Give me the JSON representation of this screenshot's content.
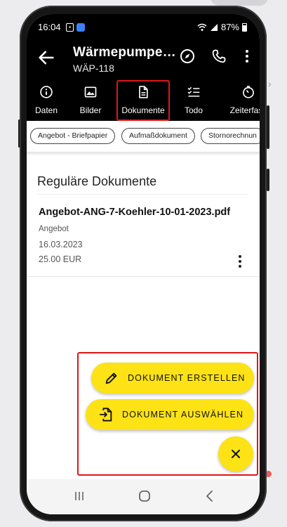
{
  "status_bar": {
    "time": "16:04",
    "battery": "87%",
    "icons": [
      "sim-icon",
      "app-notification-icon",
      "wifi-icon",
      "signal-icon",
      "battery-icon"
    ]
  },
  "app_bar": {
    "title": "Wärmepumpe…",
    "subtitle": "WÄP-118",
    "icons": [
      "back-arrow-icon",
      "compass-icon",
      "phone-icon",
      "more-vert-icon"
    ]
  },
  "tabs": [
    {
      "label": "Daten",
      "icon": "info-icon"
    },
    {
      "label": "Bilder",
      "icon": "image-icon"
    },
    {
      "label": "Dokumente",
      "icon": "document-icon",
      "selected": true
    },
    {
      "label": "Todo",
      "icon": "checklist-icon"
    },
    {
      "label": "Zeiterfass",
      "icon": "timer-icon"
    }
  ],
  "filter_chips": [
    "Angebot - Briefpapier",
    "Aufmaßdokument",
    "Stornorechnun"
  ],
  "section": {
    "title": "Reguläre Dokumente"
  },
  "document": {
    "name": "Angebot-ANG-7-Koehler-10-01-2023.pdf",
    "type": "Angebot",
    "date": "16.03.2023",
    "price": "25.00 EUR"
  },
  "fab_menu": {
    "create_label": "DOKUMENT ERSTELLEN",
    "select_label": "DOKUMENT AUSWÄHLEN",
    "close_icon": "close-icon"
  },
  "colors": {
    "accent_yellow": "#fde216",
    "highlight_red": "#e01616",
    "appbar_black": "#000000"
  },
  "nav_bar": {
    "icons": [
      "recent-apps-icon",
      "home-icon",
      "back-icon"
    ]
  }
}
